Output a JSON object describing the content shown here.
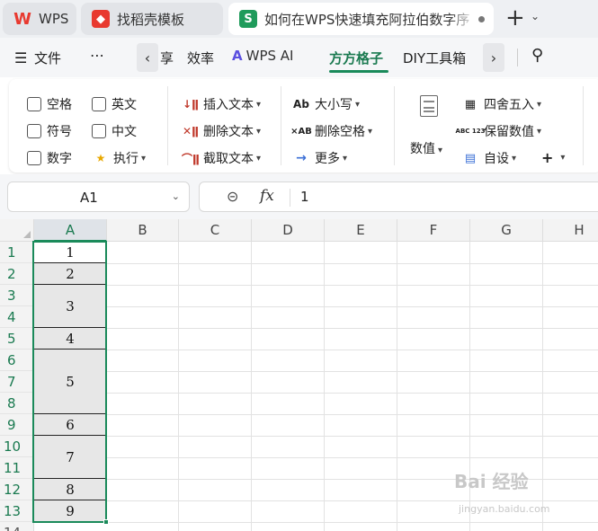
{
  "tabs": [
    {
      "label": "WPS",
      "icon": "wps-logo-icon",
      "color": "#e8392f"
    },
    {
      "label": "找稻壳模板",
      "icon": "docer-icon",
      "color": "#e8392f"
    },
    {
      "label": "如何在WPS快速填充阿拉伯数字序",
      "icon": "spreadsheet-s-icon",
      "color": "#1f9b5b",
      "active": true
    }
  ],
  "menu": {
    "items": [
      "文件",
      "享",
      "效率",
      "WPS AI",
      "方方格子",
      "DIY工具箱"
    ],
    "selected": "方方格子"
  },
  "ribbon": {
    "checkboxes": [
      "空格",
      "英文",
      "符号",
      "中文",
      "数字"
    ],
    "exec_label": "执行",
    "text_ops": [
      "插入文本",
      "删除文本",
      "截取文本"
    ],
    "case_ops": [
      "大小写",
      "删除空格",
      "更多"
    ],
    "case_icons": [
      "Ab",
      "×AB",
      "→"
    ],
    "value_label": "数值",
    "round_ops": [
      "四舍五入",
      "保留数值",
      "自设"
    ],
    "round_icons": [
      "ABC 123"
    ]
  },
  "formula": {
    "name_box": "A1",
    "value": "1"
  },
  "columns": [
    "A",
    "B",
    "C",
    "D",
    "E",
    "F",
    "G",
    "H"
  ],
  "rows": [
    "1",
    "2",
    "3",
    "4",
    "5",
    "6",
    "7",
    "8",
    "9",
    "10",
    "11",
    "12",
    "13",
    "14"
  ],
  "cells_A": [
    "1",
    "2",
    "3",
    "4",
    "5",
    "6",
    "7",
    "8",
    "9"
  ],
  "watermark": {
    "text": "Bai 经验",
    "url": "jingyan.baidu.com"
  }
}
